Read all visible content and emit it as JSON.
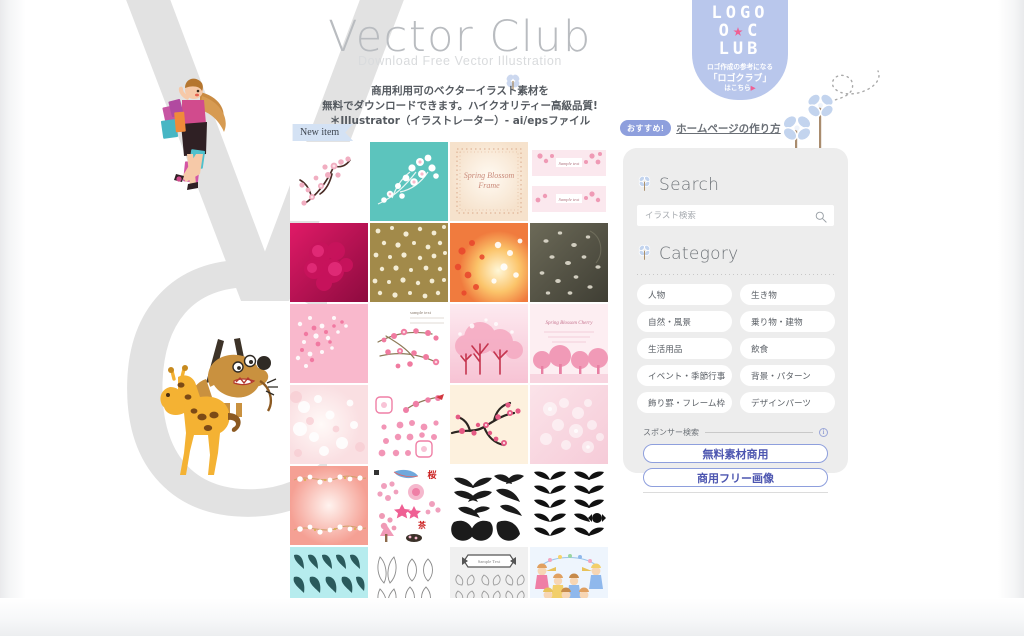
{
  "header": {
    "title": "Vector Club",
    "subtitle": "Download Free Vector Illustration",
    "divider_icon": "clover-icon",
    "lead_lines": [
      "商用利用可のベクターイラスト素材を",
      "無料でダウンロードできます。ハイクオリティー高級品質!",
      "＊Illustrator（イラストレーター）- ai/epsファイル"
    ]
  },
  "logo_club": {
    "row1": "LOGO",
    "row2_left": "O",
    "row2_star": "★",
    "row2_right": "C",
    "row3": "LUB",
    "caption_line1": "ロゴ作成の参考になる",
    "caption_line2": "「ロゴクラブ」",
    "caption_line3": "はこちら",
    "caption_arrow": "▶",
    "bg_color": "#b9c7ec",
    "star_color": "#ef5f93"
  },
  "recommend": {
    "badge": "おすすめ!",
    "link": "ホームページの作り方",
    "badge_color": "#8e9fdd"
  },
  "new_item_tag": {
    "label": "New item",
    "bg_color": "#d4e2f4"
  },
  "gallery": {
    "columns": 4,
    "thumbnails": [
      {
        "id": "t1",
        "alt": "cherry-blossom-branch-white",
        "bg": "#ffffff"
      },
      {
        "id": "t2",
        "alt": "sakura-on-teal",
        "bg": "#5cc4bd"
      },
      {
        "id": "t3",
        "alt": "spring-blossom-frame-cream",
        "bg": "#fbf1e4"
      },
      {
        "id": "t4",
        "alt": "pink-blossom-banners-pair",
        "bg": "#ffffff"
      },
      {
        "id": "t5",
        "alt": "magenta-paper-flowers",
        "bg": "#c31254"
      },
      {
        "id": "t6",
        "alt": "gold-sakura-pattern",
        "bg": "#a28a4a"
      },
      {
        "id": "t7",
        "alt": "orange-glow-blossom",
        "bg": "#f6a960"
      },
      {
        "id": "t8",
        "alt": "dark-olive-petals",
        "bg": "#5b5a4a"
      },
      {
        "id": "t9",
        "alt": "pink-petal-confetti",
        "bg": "#f9b8cc"
      },
      {
        "id": "t10",
        "alt": "plum-branch-sample-text",
        "bg": "#ffffff"
      },
      {
        "id": "t11",
        "alt": "pink-cherry-trees",
        "bg": "#fbdbe4"
      },
      {
        "id": "t12",
        "alt": "spring-blossom-cherry-trees-row",
        "bg": "#fdeef2"
      },
      {
        "id": "t13",
        "alt": "soft-pink-bokeh",
        "bg": "#fdeef0"
      },
      {
        "id": "t14",
        "alt": "sakura-stamp-icon-set",
        "bg": "#ffffff"
      },
      {
        "id": "t15",
        "alt": "ink-plum-branch-cream",
        "bg": "#fdf1de"
      },
      {
        "id": "t16",
        "alt": "pale-pink-blossom-wash",
        "bg": "#fadfe6"
      },
      {
        "id": "t17",
        "alt": "peach-blossom-border-frame",
        "bg": "#f6a89c"
      },
      {
        "id": "t18",
        "alt": "spring-illustration-sticker-set",
        "bg": "#ffffff"
      },
      {
        "id": "t19",
        "alt": "black-wings-silhouette-set",
        "bg": "#ffffff"
      },
      {
        "id": "t20",
        "alt": "black-wings-grid-set",
        "bg": "#ffffff"
      },
      {
        "id": "t21",
        "alt": "teal-wings-silhouette-set",
        "bg": "#b6ecee"
      },
      {
        "id": "t22",
        "alt": "outline-wings-sketch-set",
        "bg": "#ffffff"
      },
      {
        "id": "t23",
        "alt": "gray-wings-banner-set",
        "bg": "#f0f0f0"
      },
      {
        "id": "t24",
        "alt": "angel-choir-illustration",
        "bg": "#eef5fd"
      }
    ]
  },
  "sidebar": {
    "search": {
      "heading": "Search",
      "heading_icon": "clover-icon",
      "placeholder": "イラスト検索",
      "value": "",
      "submit_icon": "search-icon"
    },
    "category": {
      "heading": "Category",
      "heading_icon": "clover-icon",
      "items": [
        "人物",
        "生き物",
        "自然・風景",
        "乗り物・建物",
        "生活用品",
        "飲食",
        "イベント・季節行事",
        "背景・パターン",
        "飾り罫・フレーム枠",
        "デザインパーツ"
      ]
    },
    "sponsor": {
      "label": "スポンサー検索",
      "info_icon": "info-icon",
      "buttons": [
        "無料素材商用",
        "商用フリー画像"
      ],
      "accent_color": "#8e9fdd",
      "text_color": "#4d56b0"
    },
    "bg_color": "#ededed"
  },
  "decor": {
    "watermark_left": "V",
    "watermark_right": "C",
    "watermark_color": "#e2e2e2",
    "illustrations": [
      {
        "name": "shopping-woman-illustration"
      },
      {
        "name": "giraffe-illustration"
      },
      {
        "name": "barking-dog-illustration"
      },
      {
        "name": "blue-flowers-illustration"
      },
      {
        "name": "dotted-swirl-line"
      }
    ],
    "flower_color": "#c3d4ee"
  }
}
